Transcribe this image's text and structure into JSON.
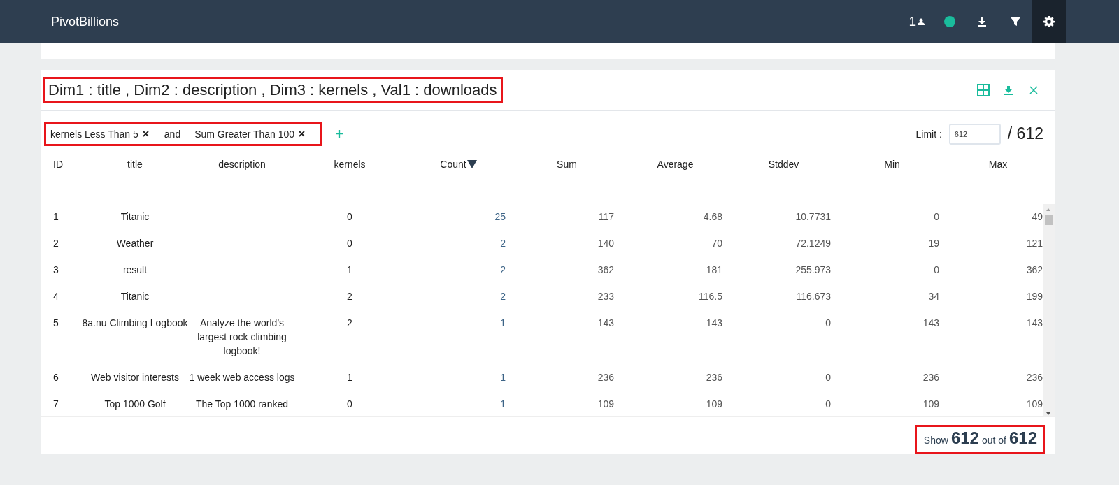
{
  "navbar": {
    "brand": "PivotBillions",
    "user_count": "1",
    "connected": true,
    "actions": [
      {
        "kind": "download",
        "selected": false
      },
      {
        "kind": "filter",
        "selected": false
      },
      {
        "kind": "settings",
        "selected": true
      }
    ]
  },
  "panel": {
    "title": "Dim1 : title , Dim2 : description , Dim3 : kernels , Val1 : downloads",
    "title_highlighted": true,
    "filters": {
      "highlighted": true,
      "items": [
        {
          "kind": "chip",
          "text": "kernels Less Than 5"
        },
        {
          "kind": "joiner",
          "text": "and"
        },
        {
          "kind": "chip",
          "text": "Sum Greater Than 100"
        }
      ]
    },
    "limit": {
      "label": "Limit :",
      "value": "612",
      "total": "/ 612"
    },
    "table": {
      "columns": [
        {
          "label": "ID",
          "kind": "dim",
          "sort_descending": false
        },
        {
          "label": "title",
          "kind": "dim",
          "sort_descending": false
        },
        {
          "label": "description",
          "kind": "dim",
          "sort_descending": false
        },
        {
          "label": "kernels",
          "kind": "dim",
          "sort_descending": false
        },
        {
          "label": "Count",
          "kind": "count",
          "sort_descending": true
        },
        {
          "label": "Sum",
          "kind": "val",
          "sort_descending": false
        },
        {
          "label": "Average",
          "kind": "val",
          "sort_descending": false
        },
        {
          "label": "Stddev",
          "kind": "val",
          "sort_descending": false
        },
        {
          "label": "Min",
          "kind": "val",
          "sort_descending": false
        },
        {
          "label": "Max",
          "kind": "val",
          "sort_descending": false
        }
      ],
      "rows": [
        [
          "1",
          "Titanic",
          "",
          "0",
          "25",
          "117",
          "4.68",
          "10.7731",
          "0",
          "49"
        ],
        [
          "2",
          "Weather",
          "",
          "0",
          "2",
          "140",
          "70",
          "72.1249",
          "19",
          "121"
        ],
        [
          "3",
          "result",
          "",
          "1",
          "2",
          "362",
          "181",
          "255.973",
          "0",
          "362"
        ],
        [
          "4",
          "Titanic",
          "",
          "2",
          "2",
          "233",
          "116.5",
          "116.673",
          "34",
          "199"
        ],
        [
          "5",
          "8a.nu Climbing Logbook",
          "Analyze the world's largest rock climbing logbook!",
          "2",
          "1",
          "143",
          "143",
          "0",
          "143",
          "143"
        ],
        [
          "6",
          "Web visitor interests",
          "1 week web access logs",
          "1",
          "1",
          "236",
          "236",
          "0",
          "236",
          "236"
        ],
        [
          "7",
          "Top 1000 Golf",
          "The Top 1000 ranked",
          "0",
          "1",
          "109",
          "109",
          "0",
          "109",
          "109"
        ]
      ]
    },
    "footer": {
      "highlighted": true,
      "label_1": "Show",
      "shown": "612",
      "label_2": "out of",
      "total": "612"
    }
  }
}
